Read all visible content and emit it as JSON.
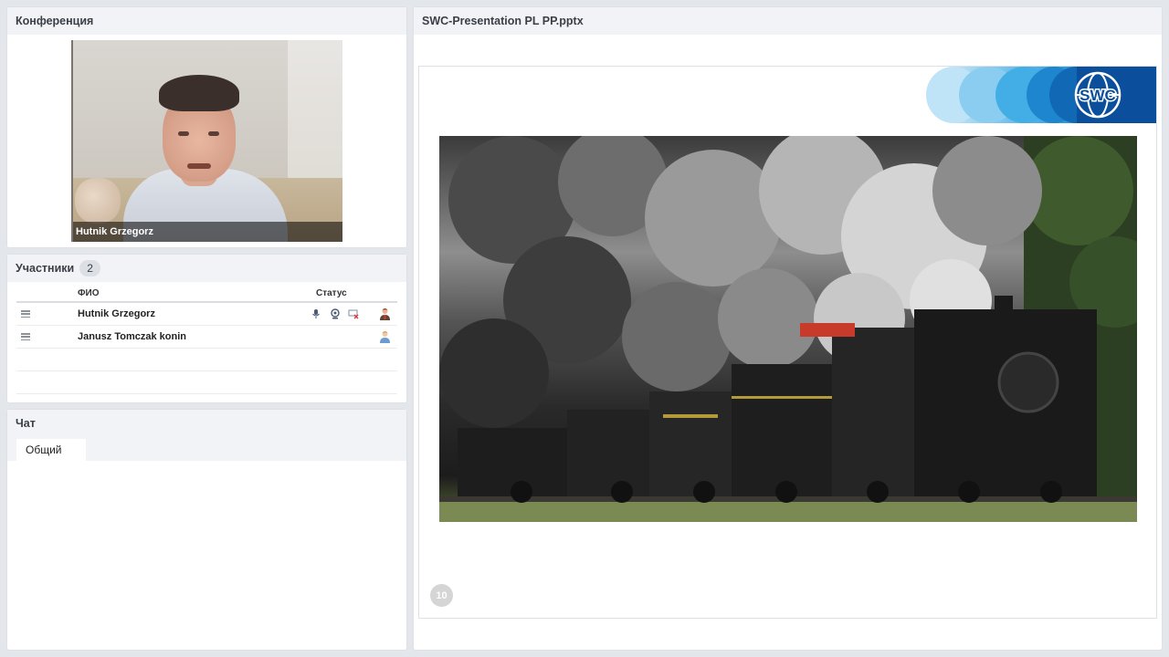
{
  "conference": {
    "title": "Конференция",
    "video_name": "Hutnik Grzegorz"
  },
  "participants": {
    "title": "Участники",
    "count": "2",
    "columns": {
      "name": "ФИО",
      "status": "Статус"
    },
    "rows": [
      {
        "name": "Hutnik Grzegorz",
        "mic": "microphone-icon",
        "cam": "webcam-icon",
        "screen": "screen-share-off-icon",
        "role": "presenter-user-icon"
      },
      {
        "name": "Janusz Tomczak konin",
        "role": "user-icon"
      }
    ]
  },
  "chat": {
    "title": "Чат",
    "tabs": [
      "Общий"
    ]
  },
  "presentation": {
    "title": "SWC-Presentation PL PP.pptx",
    "logo_text": "SWC",
    "page": "10",
    "colors": {
      "logo_dark": "#0b4f9c",
      "logo_light": "#5ab6e8"
    }
  }
}
